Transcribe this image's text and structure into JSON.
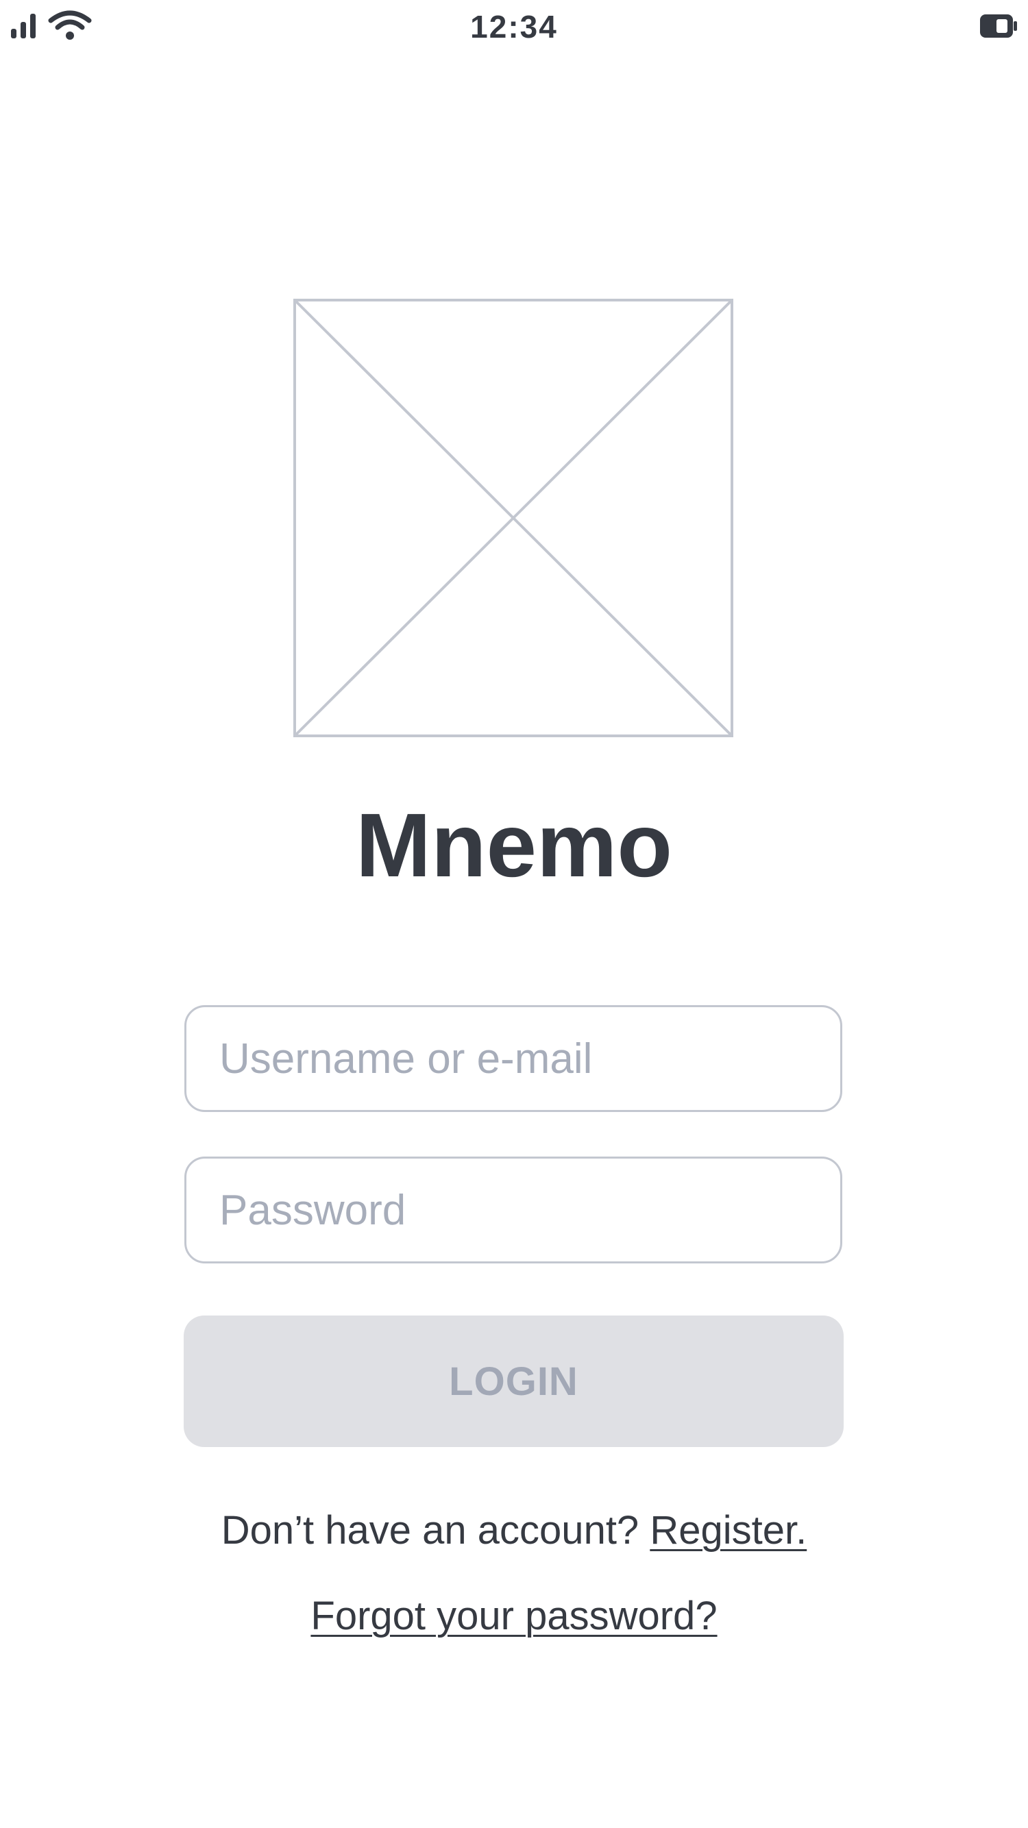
{
  "status_bar": {
    "time": "12:34",
    "icons": [
      "signal-icon",
      "wifi-icon",
      "battery-icon"
    ]
  },
  "logo": {
    "icon": "image-placeholder-icon",
    "stroke_color": "#c3c7d0"
  },
  "app": {
    "title": "Mnemo"
  },
  "form": {
    "username_placeholder": "Username or e-mail",
    "username_value": "",
    "password_placeholder": "Password",
    "password_value": "",
    "login_label": "LOGIN",
    "login_state": "disabled"
  },
  "footer": {
    "register_prompt": "Don’t have an account?",
    "register_link": "Register.",
    "forgot_link": "Forgot your password?"
  },
  "colors": {
    "text": "#363a42",
    "placeholder": "#a7adba",
    "field_border": "#c3c7d0",
    "button_bg": "#dfe0e4",
    "button_text": "#a2a8b6"
  }
}
